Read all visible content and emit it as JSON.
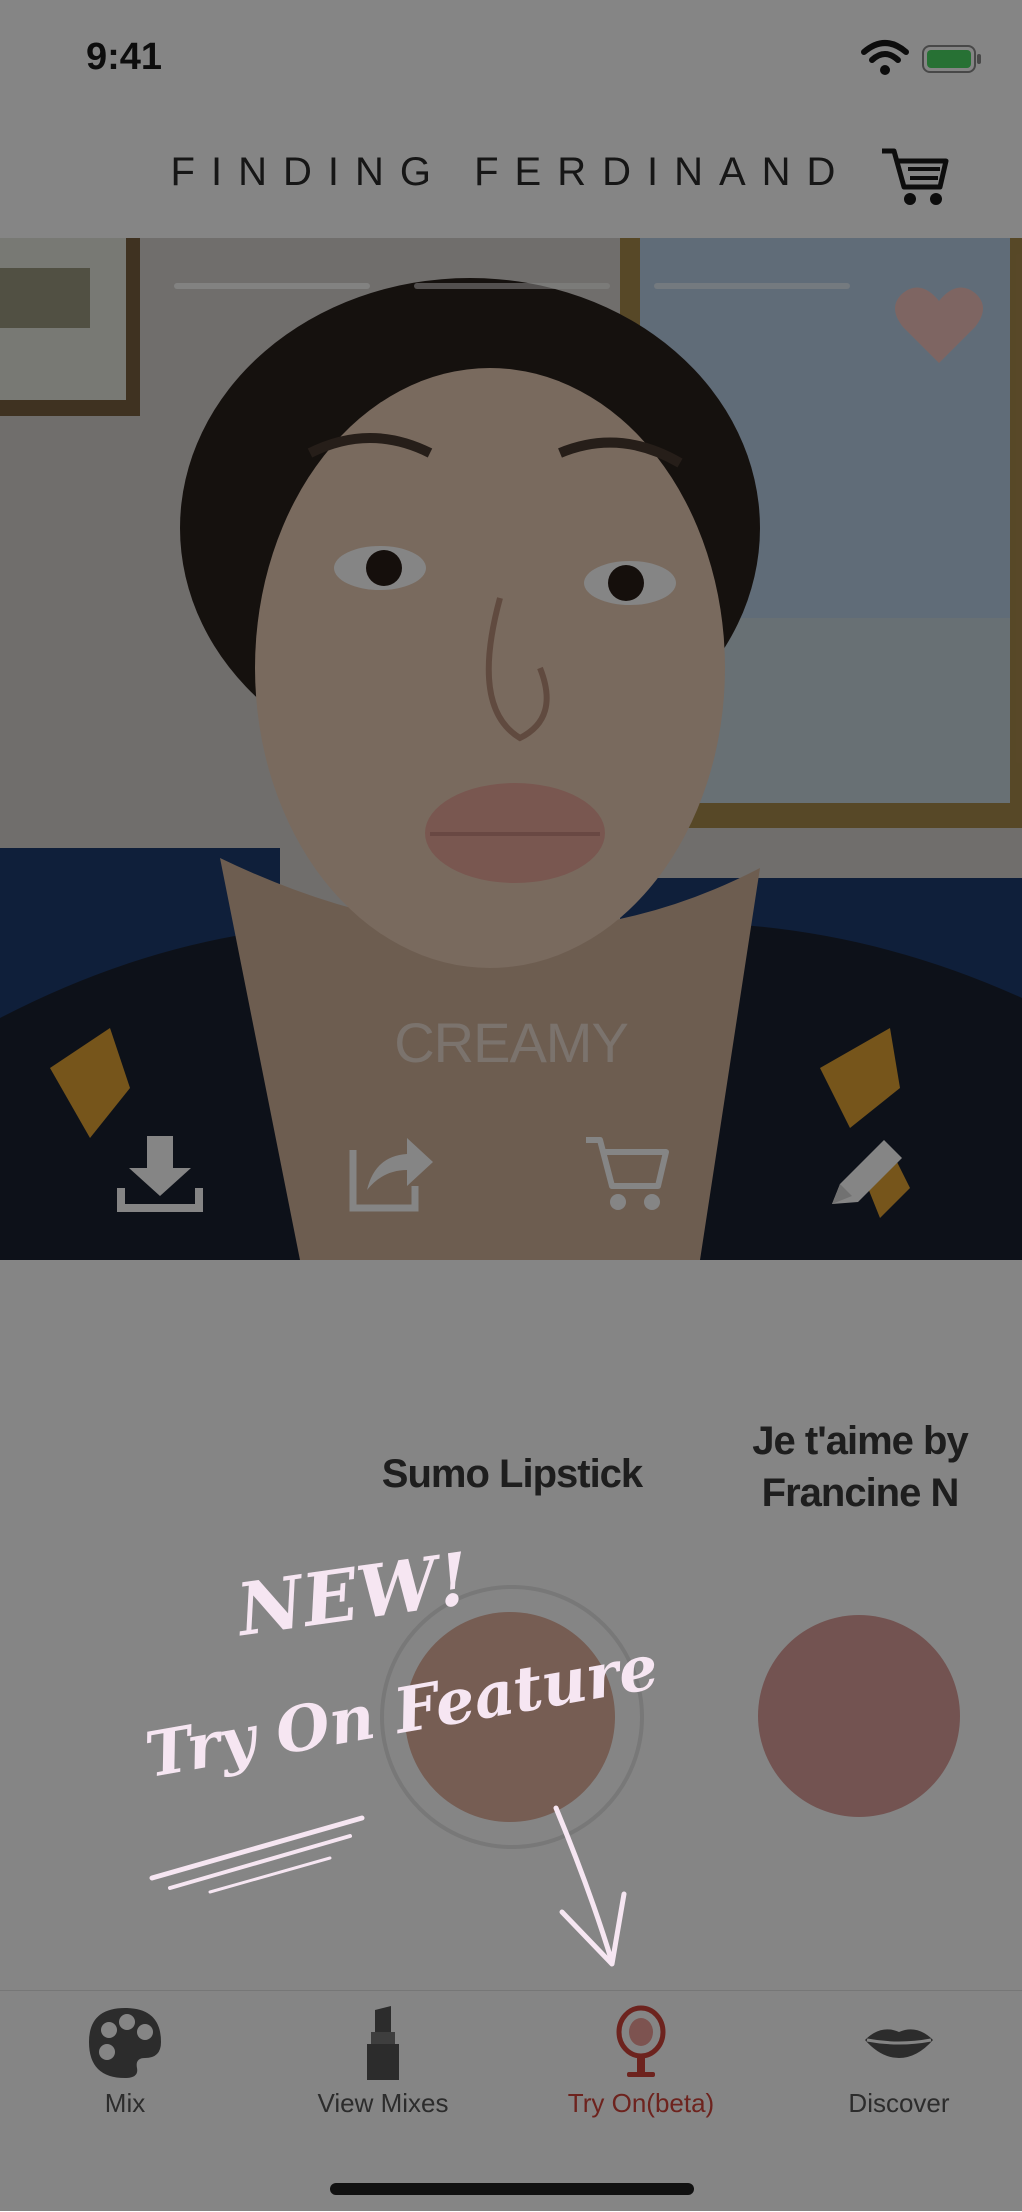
{
  "status_bar": {
    "time": "9:41",
    "icons": [
      "wifi-icon",
      "battery-icon"
    ]
  },
  "header": {
    "brand": "FINDING FERDINAND",
    "cart_icon": "cart-icon"
  },
  "camera": {
    "finish_label": "CREAMY",
    "story_progress_segments": 3,
    "like_icon": "heart-icon",
    "actions": [
      {
        "name": "download",
        "icon": "download-icon"
      },
      {
        "name": "share",
        "icon": "share-icon"
      },
      {
        "name": "add-to-cart",
        "icon": "cart-icon"
      },
      {
        "name": "edit",
        "icon": "pencil-icon"
      }
    ]
  },
  "products": [
    {
      "name": "Sumo Lipstick",
      "color": "#e2b2a0",
      "selected": true
    },
    {
      "name": "Je t'aime by Francine N",
      "color": "#dca09c",
      "selected": false
    }
  ],
  "annotation": {
    "line1": "NEW!",
    "line2": "Try On Feature"
  },
  "tab_bar": {
    "active_color": "#d2443a",
    "tabs": [
      {
        "label": "Mix",
        "icon": "palette-icon",
        "active": false
      },
      {
        "label": "View Mixes",
        "icon": "lipstick-icon",
        "active": false
      },
      {
        "label": "Try On(beta)",
        "icon": "mirror-icon",
        "active": true
      },
      {
        "label": "Discover",
        "icon": "lips-icon",
        "active": false
      }
    ]
  }
}
